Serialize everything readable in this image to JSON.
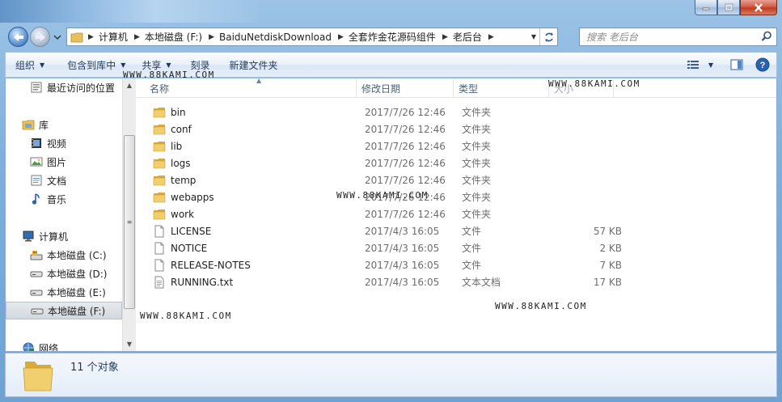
{
  "window": {
    "caption_minimize": "minimize",
    "caption_maximize": "maximize",
    "caption_close": "close"
  },
  "address": {
    "crumbs": [
      "计算机",
      "本地磁盘 (F:)",
      "BaiduNetdiskDownload",
      "全套炸金花源码组件",
      "老后台"
    ]
  },
  "search": {
    "placeholder": "搜索 老后台"
  },
  "toolbar": {
    "organize": "组织",
    "include_library": "包含到库中",
    "share": "共享",
    "burn": "刻录",
    "new_folder": "新建文件夹"
  },
  "nav": {
    "recent": "最近访问的位置",
    "libraries": "库",
    "video": "视频",
    "pictures": "图片",
    "documents": "文档",
    "music": "音乐",
    "computer": "计算机",
    "drive_c": "本地磁盘 (C:)",
    "drive_d": "本地磁盘 (D:)",
    "drive_e": "本地磁盘 (E:)",
    "drive_f": "本地磁盘 (F:)",
    "network": "网络"
  },
  "columns": {
    "name": "名称",
    "modified": "修改日期",
    "type": "类型",
    "size": "大小"
  },
  "files": [
    {
      "name": "bin",
      "date": "2017/7/26 12:46",
      "type": "文件夹",
      "size": "",
      "kind": "folder"
    },
    {
      "name": "conf",
      "date": "2017/7/26 12:46",
      "type": "文件夹",
      "size": "",
      "kind": "folder"
    },
    {
      "name": "lib",
      "date": "2017/7/26 12:46",
      "type": "文件夹",
      "size": "",
      "kind": "folder"
    },
    {
      "name": "logs",
      "date": "2017/7/26 12:46",
      "type": "文件夹",
      "size": "",
      "kind": "folder"
    },
    {
      "name": "temp",
      "date": "2017/7/26 12:46",
      "type": "文件夹",
      "size": "",
      "kind": "folder"
    },
    {
      "name": "webapps",
      "date": "2017/7/26 12:46",
      "type": "文件夹",
      "size": "",
      "kind": "folder"
    },
    {
      "name": "work",
      "date": "2017/7/26 12:46",
      "type": "文件夹",
      "size": "",
      "kind": "folder"
    },
    {
      "name": "LICENSE",
      "date": "2017/4/3 16:05",
      "type": "文件",
      "size": "57 KB",
      "kind": "file"
    },
    {
      "name": "NOTICE",
      "date": "2017/4/3 16:05",
      "type": "文件",
      "size": "2 KB",
      "kind": "file"
    },
    {
      "name": "RELEASE-NOTES",
      "date": "2017/4/3 16:05",
      "type": "文件",
      "size": "7 KB",
      "kind": "file"
    },
    {
      "name": "RUNNING.txt",
      "date": "2017/4/3 16:05",
      "type": "文本文档",
      "size": "17 KB",
      "kind": "text"
    }
  ],
  "status": {
    "count": "11 个对象"
  },
  "watermark": {
    "text": "WWW.88KAMI.COM"
  },
  "colors": {
    "frame": "#7fb0dc",
    "toolbar_text": "#1e395b",
    "folder": "#e8c15a"
  }
}
